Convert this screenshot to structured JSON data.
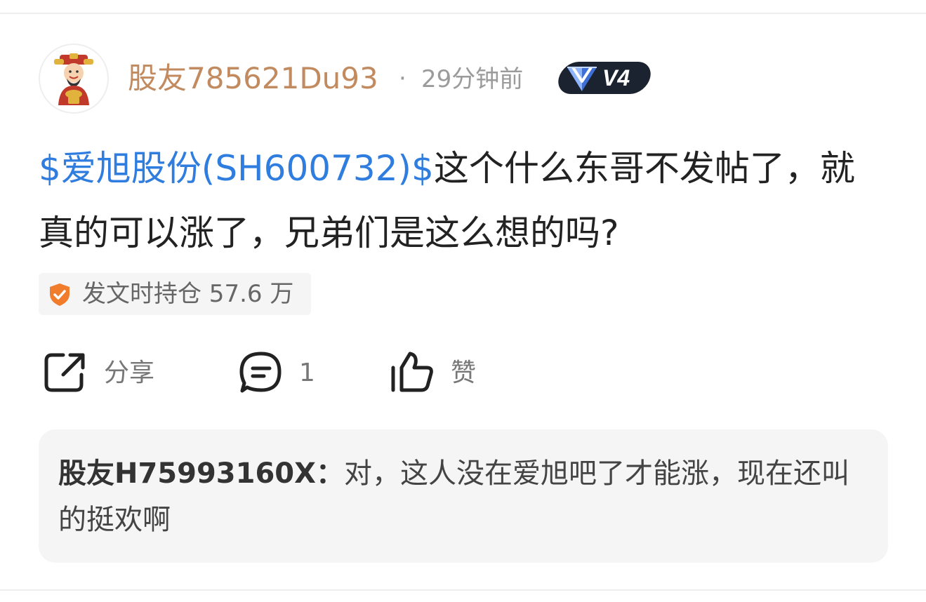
{
  "post": {
    "username": "股友785621Du93",
    "separator": "·",
    "time_ago": "29分钟前",
    "level_badge": "V4",
    "stock_tag": "$爱旭股份(SH600732)$",
    "content": "这个什么东哥不发帖了，就真的可以涨了，兄弟们是这么想的吗?",
    "holding_label": "发文时持仓 57.6 万"
  },
  "actions": {
    "share_label": "分享",
    "comment_count": "1",
    "like_label": "赞"
  },
  "reply": {
    "user": "股友H75993160X：",
    "text": "对，这人没在爱旭吧了才能涨，现在还叫的挺欢啊"
  },
  "colors": {
    "username": "#c28a5f",
    "stock_link": "#2f7ddf",
    "muted": "#9b9b9b",
    "chip_bg": "#f5f5f6",
    "shield": "#f07c2c",
    "badge_bg": "#1c2330"
  },
  "icons": {
    "avatar": "fortune-god-avatar",
    "badge": "diamond-level-icon",
    "holding": "shield-check-icon",
    "share": "share-icon",
    "comment": "comment-icon",
    "like": "thumbs-up-icon"
  }
}
